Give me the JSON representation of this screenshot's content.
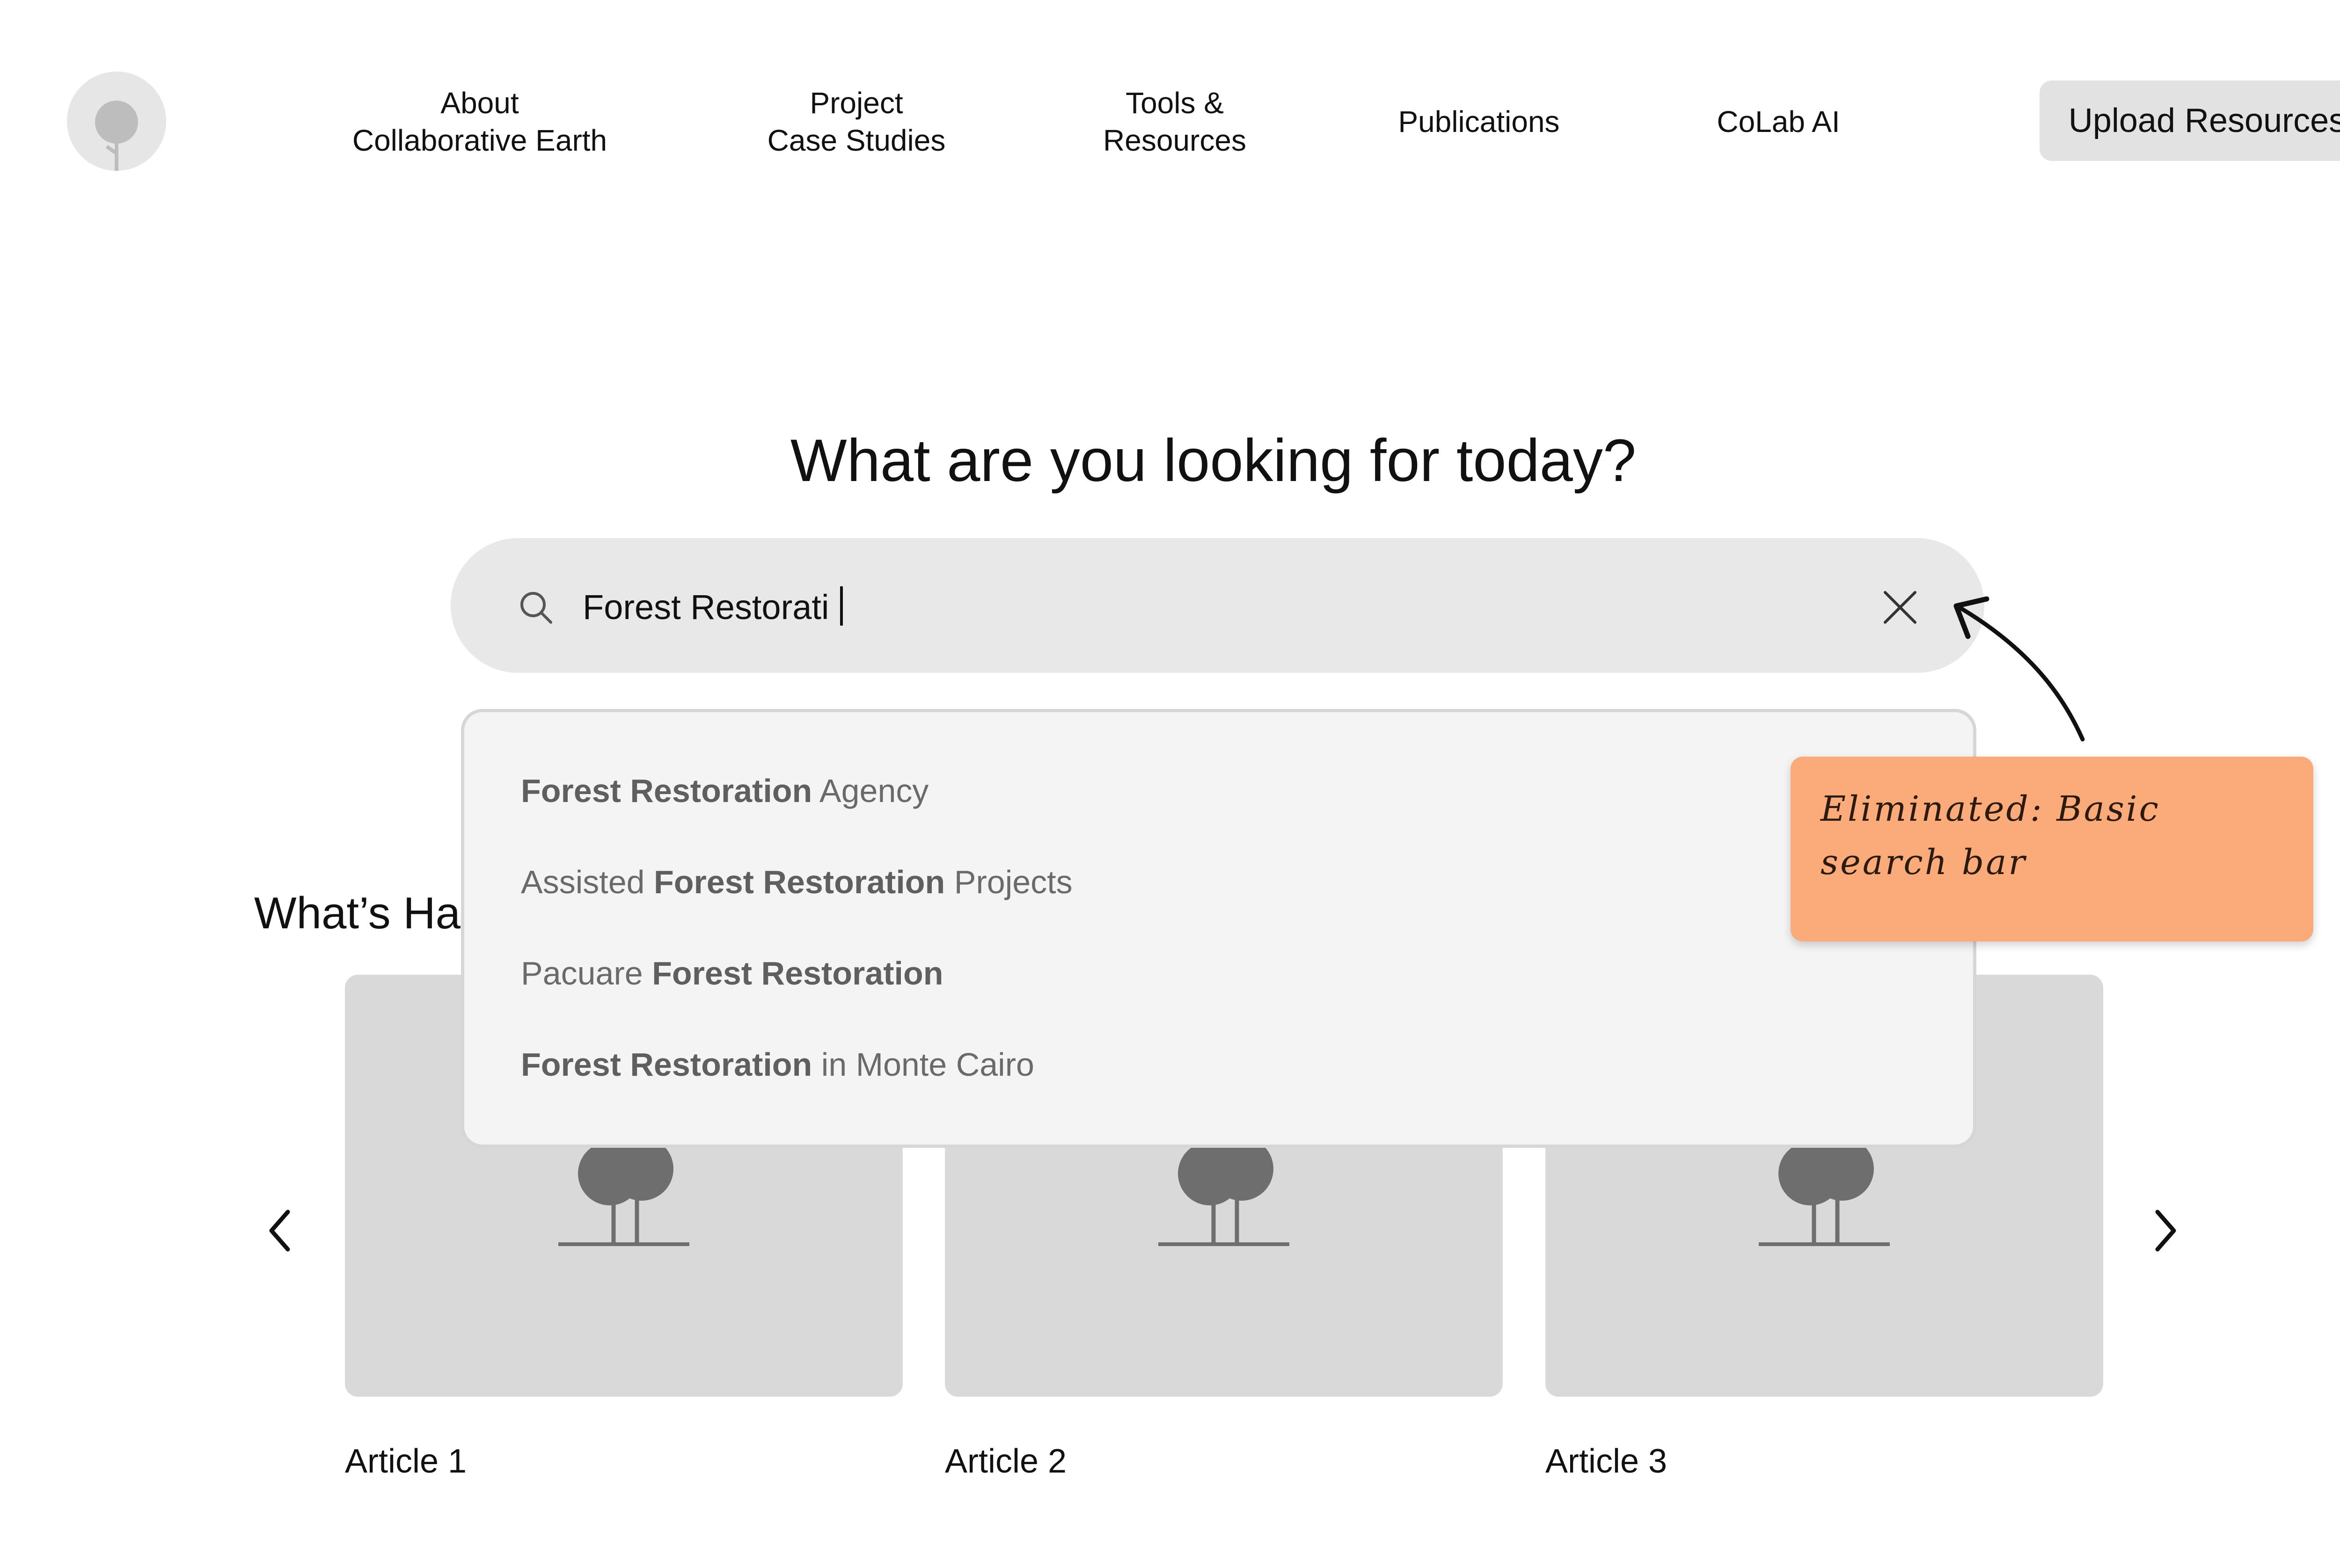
{
  "header": {
    "logo_icon": "tree-logo-icon",
    "nav": [
      {
        "label": "About\nCollaborative Earth"
      },
      {
        "label": "Project\nCase Studies"
      },
      {
        "label": "Tools &\nResources"
      },
      {
        "label": "Publications"
      },
      {
        "label": "CoLab AI"
      }
    ],
    "upload_label": "Upload Resources"
  },
  "hero": {
    "heading": "What are you looking for today?"
  },
  "search": {
    "value": "Forest Restorati",
    "icon": "search-icon",
    "clear_icon": "close-icon"
  },
  "suggestions": [
    {
      "pre": "",
      "bold": "Forest Restoration",
      "post": " Agency"
    },
    {
      "pre": "Assisted ",
      "bold": "Forest Restoration",
      "post": " Projects"
    },
    {
      "pre": "Pacuare ",
      "bold": "Forest Restoration",
      "post": ""
    },
    {
      "pre": "",
      "bold": "Forest Restoration",
      "post": " in Monte Cairo"
    }
  ],
  "section": {
    "title_visible": "What’s Ha"
  },
  "articles": [
    {
      "label": "Article 1"
    },
    {
      "label": "Article 2"
    },
    {
      "label": "Article 3"
    }
  ],
  "annotation": {
    "text": "Eliminated: Basic search bar",
    "color": "#fbaa79"
  },
  "colors": {
    "search_bg": "#e8e8e8",
    "dropdown_bg": "#f4f4f4",
    "card_bg": "#d9d9d9",
    "button_bg": "#e2e2e2"
  }
}
